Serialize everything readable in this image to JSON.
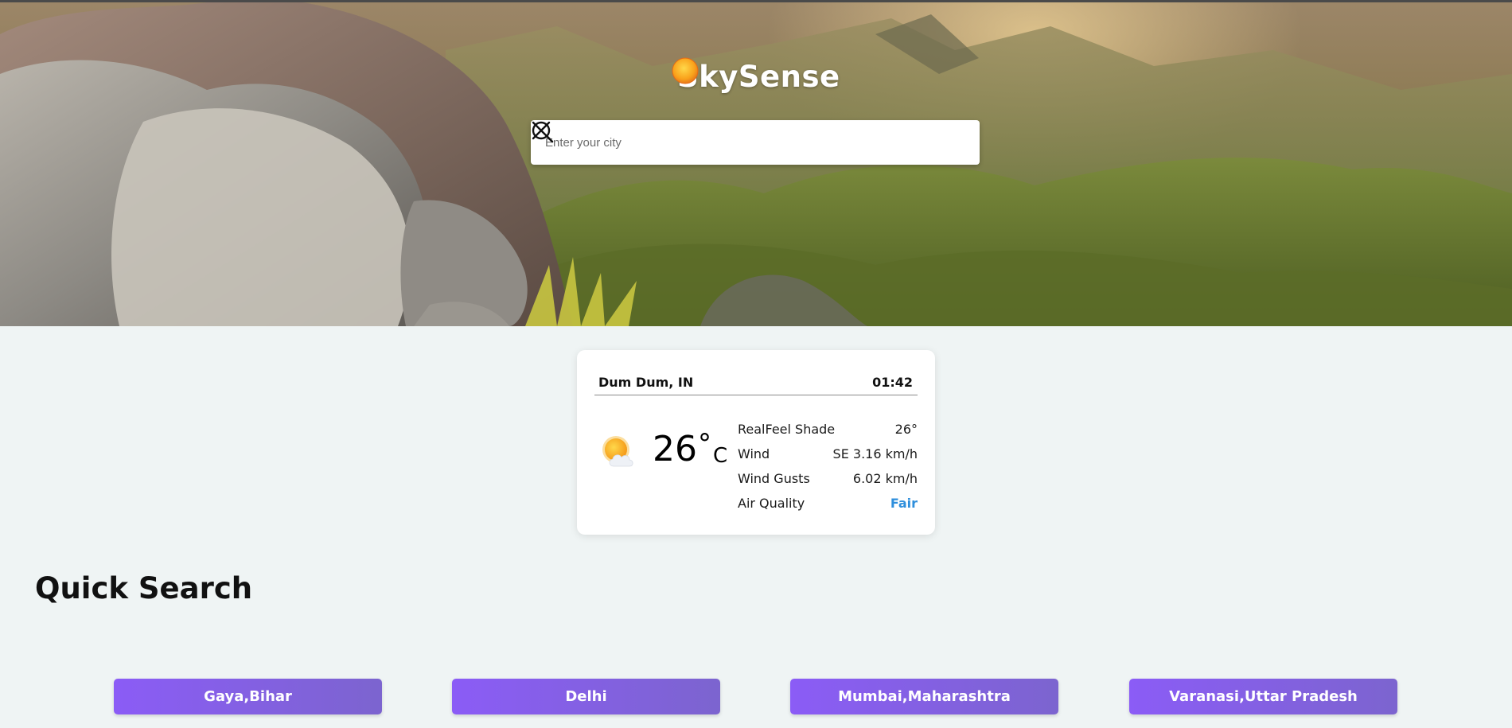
{
  "app": {
    "name": "SkySense",
    "logo_icon": "sun-icon"
  },
  "search": {
    "placeholder": "Enter your city",
    "value": "",
    "clear_icon": "close-icon",
    "submit_icon": "search-icon"
  },
  "weather": {
    "location": "Dum Dum, IN",
    "time": "01:42",
    "condition_icon": "partly-cloudy-sun-icon",
    "temperature": "26",
    "degree_symbol": "°",
    "unit": "C",
    "details": [
      {
        "label": "RealFeel Shade",
        "value": "26°"
      },
      {
        "label": "Wind",
        "value": "SE 3.16 km/h"
      },
      {
        "label": "Wind Gusts",
        "value": "6.02 km/h"
      },
      {
        "label": "Air Quality",
        "value": "Fair"
      }
    ],
    "air_quality_color": "#2f8fdc"
  },
  "quick_search": {
    "title": "Quick Search",
    "cities": [
      "Gaya,Bihar",
      "Delhi",
      "Mumbai,Maharashtra",
      "Varanasi,Uttar Pradesh"
    ],
    "button_color": "#8b5cf6"
  }
}
